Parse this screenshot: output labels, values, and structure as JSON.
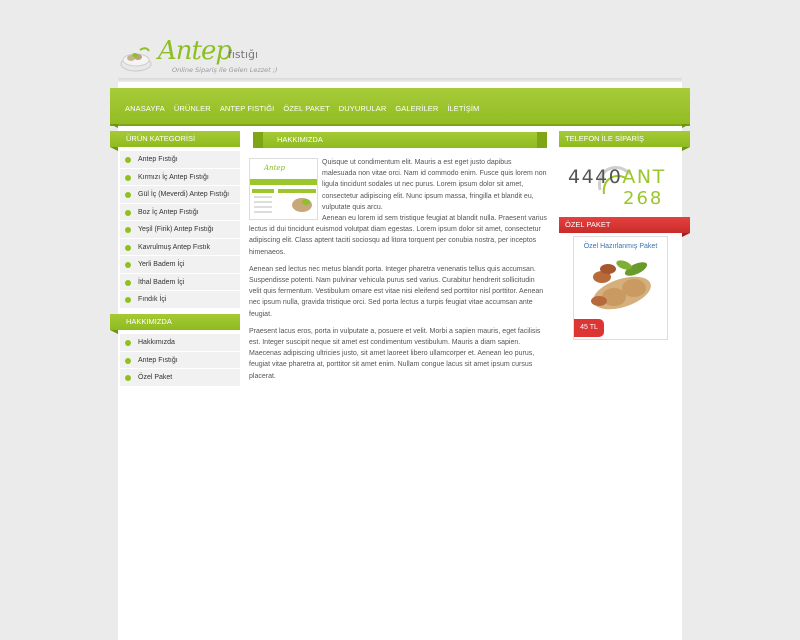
{
  "logo": {
    "word": "Antep",
    "small": "fıstığı",
    "tagline": "Online Sipariş ile    Gelen Lezzet ;)"
  },
  "nav": [
    "ANASAYFA",
    "ÜRÜNLER",
    "ANTEP FISTIĞI",
    "ÖZEL PAKET",
    "DUYURULAR",
    "GALERİLER",
    "İLETİŞİM"
  ],
  "left": {
    "categories_title": "ÜRÜN KATEGORİSİ",
    "categories": [
      "Antep Fıstığı",
      "Kırmızı İç Antep Fıstığı",
      "Gül İç (Meverdi) Antep Fıstığı",
      "Boz İç Antep Fıstığı",
      "Yeşil (Firik) Antep Fıstığı",
      "Kavrulmuş Antep Fıstık",
      "Yerli Badem İçi",
      "İthal Badem İçi",
      "Fındık İçi"
    ],
    "about_title": "HAKKIMIZDA",
    "about": [
      "Hakkımızda",
      "Antep Fıstığı",
      "Özel Paket"
    ]
  },
  "content": {
    "title": "Hakkımızda",
    "paragraphs": [
      "Quisque ut condimentum elit. Mauris a est eget justo dapibus malesuada non vitae orci. Nam id commodo enim. Fusce quis lorem non ligula tincidunt sodales ut nec purus. Lorem ipsum dolor sit amet, consectetur adipiscing elit. Nunc ipsum massa, fringilla et blandit eu, vulputate quis arcu.",
      "Aenean eu lorem id sem tristique feugiat at blandit nulla. Praesent varius lectus id dui tincidunt euismod volutpat diam egestas. Lorem ipsum dolor sit amet, consectetur adipiscing elit. Class aptent taciti sociosqu ad litora torquent per conubia nostra, per inceptos himenaeos.",
      "Aenean sed lectus nec metus blandit porta. Integer pharetra venenatis tellus quis accumsan. Suspendisse potenti. Nam pulvinar vehicula purus sed varius. Curabitur hendrerit sollicitudin velit quis fermentum. Vestibulum ornare est vitae nisi eleifend sed porttitor nisl porttitor. Aenean nec ipsum nulla, gravida tristique orci. Sed porta lectus a turpis feugiat vitae accumsan ante feugiat.",
      "Praesent lacus eros, porta in vulputate a, posuere et velit. Morbi a sapien mauris, eget facilisis est. Integer suscipit neque sit amet est condimentum vestibulum. Mauris a diam sapien. Maecenas adipiscing ultricies justo, sit amet laoreet libero ullamcorper et. Aenean leo purus, feugiat vitae pharetra at, porttitor sit amet enim. Nullam congue lacus sit amet ipsum cursus placerat."
    ]
  },
  "right": {
    "phone_title": "TELEFON İLE SİPARİŞ",
    "phone_num1": "4440",
    "phone_ant": "ANT",
    "phone_num2": "268",
    "special_title": "ÖZEL PAKET",
    "special_name": "Özel Hazırlanmış Paket",
    "special_price": "45 TL"
  },
  "colors": {
    "green": "#9bc62d",
    "red": "#dd3434",
    "link_blue": "#3b72b3"
  }
}
